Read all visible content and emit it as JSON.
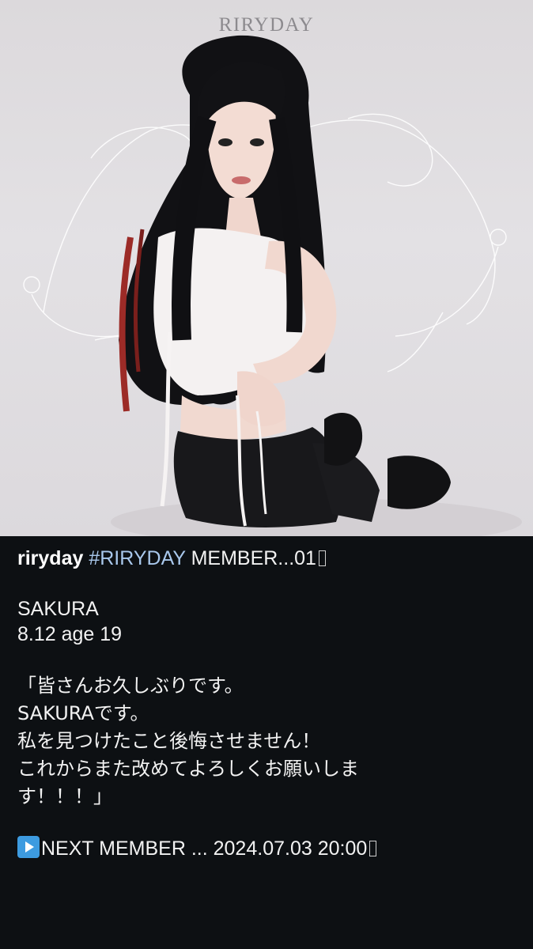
{
  "photo": {
    "brand": "RIRYDAY",
    "alt": "SAKURA teaser photo"
  },
  "caption": {
    "username": "riryday",
    "hashtag": "#RIRYDAY",
    "title_rest": "MEMBER...01",
    "name": "SAKURA",
    "info": "8.12 age 19",
    "quote_lines": [
      "「皆さんお久しぶりです。",
      "SAKURAです。",
      "私を見つけたこと後悔させません！",
      "これからまた改めてよろしくお願いしま",
      "す！！！」"
    ],
    "next_text": "NEXT MEMBER ... 2024.07.03 20:00"
  },
  "icons": {
    "next": "play-button-icon",
    "missing_glyph": "box-glyph-icon"
  },
  "colors": {
    "background": "#0d1013",
    "hashtag": "#a9c8ec",
    "text": "#f2f2f2",
    "next_icon": "#3d9be0"
  }
}
